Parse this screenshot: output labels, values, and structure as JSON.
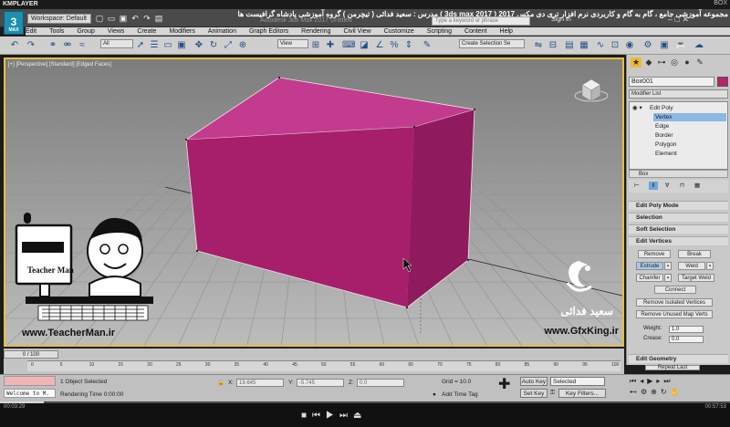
{
  "player": {
    "logo": "KMPLAYER",
    "right_text": "BOX"
  },
  "app": {
    "logo_text": "3",
    "logo_sub": "MAX",
    "workspace_label": "Workspace: Default",
    "title": "Autodesk 3ds Max 2017    Untitled",
    "search_placeholder": "Type a keyword or phrase",
    "sign_in": "Sign In",
    "banner": "مجموعه آموزشی جامع ، گام به گام و کاربردی نرم افزار تری دی مکس 2017 ( 3ds max 2017 ) مدرس : سعید فدائی ( تیچرمن ) گروه آموزشی پادشاه گرافیست ها"
  },
  "menu": [
    "Edit",
    "Tools",
    "Group",
    "Views",
    "Create",
    "Modifiers",
    "Animation",
    "Graph Editors",
    "Rendering",
    "Civil View",
    "Customize",
    "Scripting",
    "Content",
    "Help"
  ],
  "toolbar": {
    "filter_value": "All",
    "view_value": "View",
    "selection_set_placeholder": "Create Selection Se"
  },
  "viewport": {
    "label": "[+] [Perspective] [Standard] [Edged Faces]",
    "object_color": "#b8226f",
    "grid_color": "#8f8f8f"
  },
  "command_panel": {
    "object_name": "Box001",
    "modifier_list": "Modifier List",
    "stack": [
      {
        "label": "Edit Poly",
        "level": 0,
        "selected": false
      },
      {
        "label": "Vertex",
        "level": 1,
        "selected": true
      },
      {
        "label": "Edge",
        "level": 1,
        "selected": false
      },
      {
        "label": "Border",
        "level": 1,
        "selected": false
      },
      {
        "label": "Polygon",
        "level": 1,
        "selected": false
      },
      {
        "label": "Element",
        "level": 1,
        "selected": false
      }
    ],
    "base_object": "Box",
    "rollouts": [
      "Edit Poly Mode",
      "Selection",
      "Soft Selection",
      "Edit Vertices"
    ],
    "edit_vertices": {
      "remove": "Remove",
      "break": "Break",
      "extrude": "Extrude",
      "weld": "Weld",
      "chamfer": "Chamfer",
      "target_weld": "Target Weld",
      "connect": "Connect",
      "remove_isolated": "Remove Isolated Vertices",
      "remove_unused": "Remove Unused Map Verts",
      "weight_label": "Weight:",
      "weight_value": "1.0",
      "crease_label": "Crease:",
      "crease_value": "0.0"
    },
    "edit_geometry": "Edit Geometry",
    "repeat_last": "Repeat Last"
  },
  "timeline": {
    "slider": "0 / 100",
    "ticks": [
      "0",
      "5",
      "10",
      "15",
      "20",
      "25",
      "30",
      "35",
      "40",
      "45",
      "50",
      "55",
      "60",
      "65",
      "70",
      "75",
      "80",
      "85",
      "90",
      "95",
      "100"
    ]
  },
  "status": {
    "welcome": "Welcome to M.",
    "selection": "1 Object Selected",
    "render_time": "Rendering Time  0:00:00",
    "x_label": "X:",
    "x_value": "19.645",
    "y_label": "Y:",
    "y_value": "-5.745",
    "z_label": "Z:",
    "z_value": "0.0",
    "grid": "Grid = 10.0",
    "add_time_tag": "Add Time Tag",
    "auto_key": "Auto Key",
    "selected": "Selected",
    "set_key": "Set Key",
    "key_filters": "Key Filters..."
  },
  "player_controls": {
    "current_time": "00:03:29",
    "total_time": "00:57:53",
    "progress_fraction": 0.06
  },
  "watermarks": {
    "teacher_brand": "Teacher Man",
    "teacher_url": "www.TeacherMan.ir",
    "gfx_name": "سعید فدائی",
    "gfx_url": "www.GfxKing.ir"
  }
}
